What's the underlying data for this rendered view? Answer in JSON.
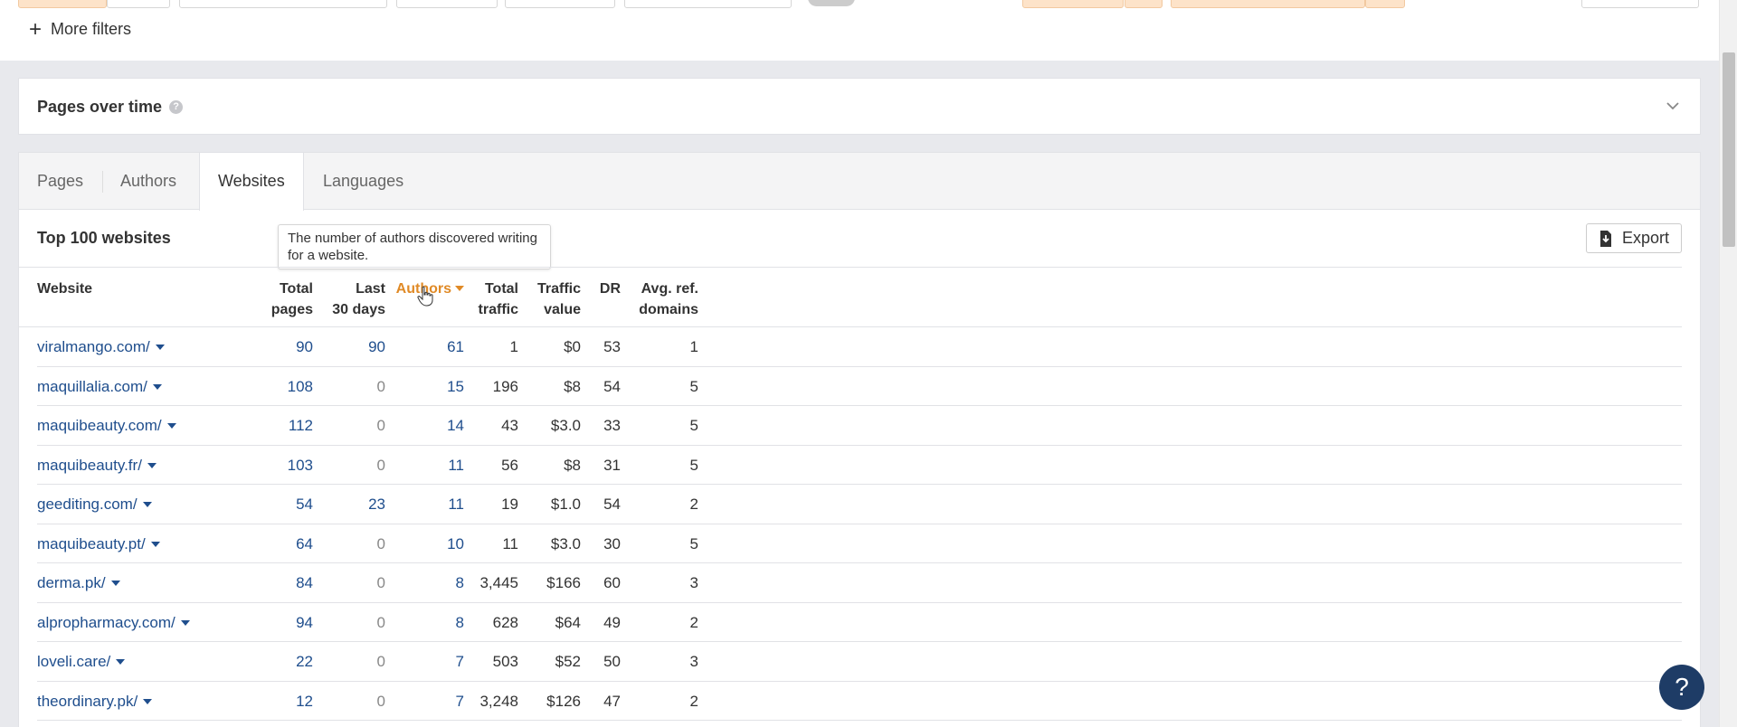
{
  "topbar": {
    "more_filters_label": "More filters"
  },
  "pages_over_time": {
    "title": "Pages over time"
  },
  "tabs": [
    {
      "label": "Pages"
    },
    {
      "label": "Authors"
    },
    {
      "label": "Websites"
    },
    {
      "label": "Languages"
    }
  ],
  "active_tab": "Websites",
  "section": {
    "title": "Top 100 websites",
    "tooltip": "The number of authors discovered writing for a website.",
    "export_label": "Export"
  },
  "table": {
    "headers": {
      "website": "Website",
      "total_pages_1": "Total",
      "total_pages_2": "pages",
      "last30_1": "Last",
      "last30_2": "30 days",
      "authors": "Authors",
      "total_traffic_1": "Total",
      "total_traffic_2": "traffic",
      "traffic_value_1": "Traffic",
      "traffic_value_2": "value",
      "dr": "DR",
      "avg_ref_1": "Avg. ref.",
      "avg_ref_2": "domains"
    },
    "rows": [
      {
        "website": "viralmango.com/",
        "total_pages": "90",
        "last30": "90",
        "authors": "61",
        "traffic": "1",
        "value": "$0",
        "dr": "53",
        "avg_ref": "1"
      },
      {
        "website": "maquillalia.com/",
        "total_pages": "108",
        "last30": "0",
        "authors": "15",
        "traffic": "196",
        "value": "$8",
        "dr": "54",
        "avg_ref": "5"
      },
      {
        "website": "maquibeauty.com/",
        "total_pages": "112",
        "last30": "0",
        "authors": "14",
        "traffic": "43",
        "value": "$3.0",
        "dr": "33",
        "avg_ref": "5"
      },
      {
        "website": "maquibeauty.fr/",
        "total_pages": "103",
        "last30": "0",
        "authors": "11",
        "traffic": "56",
        "value": "$8",
        "dr": "31",
        "avg_ref": "5"
      },
      {
        "website": "geediting.com/",
        "total_pages": "54",
        "last30": "23",
        "authors": "11",
        "traffic": "19",
        "value": "$1.0",
        "dr": "54",
        "avg_ref": "2"
      },
      {
        "website": "maquibeauty.pt/",
        "total_pages": "64",
        "last30": "0",
        "authors": "10",
        "traffic": "11",
        "value": "$3.0",
        "dr": "30",
        "avg_ref": "5"
      },
      {
        "website": "derma.pk/",
        "total_pages": "84",
        "last30": "0",
        "authors": "8",
        "traffic": "3,445",
        "value": "$166",
        "dr": "60",
        "avg_ref": "3"
      },
      {
        "website": "alpropharmacy.com/",
        "total_pages": "94",
        "last30": "0",
        "authors": "8",
        "traffic": "628",
        "value": "$64",
        "dr": "49",
        "avg_ref": "2"
      },
      {
        "website": "loveli.care/",
        "total_pages": "22",
        "last30": "0",
        "authors": "7",
        "traffic": "503",
        "value": "$52",
        "dr": "50",
        "avg_ref": "3"
      },
      {
        "website": "theordinary.pk/",
        "total_pages": "12",
        "last30": "0",
        "authors": "7",
        "traffic": "3,248",
        "value": "$126",
        "dr": "47",
        "avg_ref": "2"
      }
    ]
  },
  "help": {
    "label": "?"
  },
  "colors": {
    "accent_orange": "#e08a26",
    "link_blue": "#1f4e8d",
    "help_navy": "#1e3c66"
  }
}
